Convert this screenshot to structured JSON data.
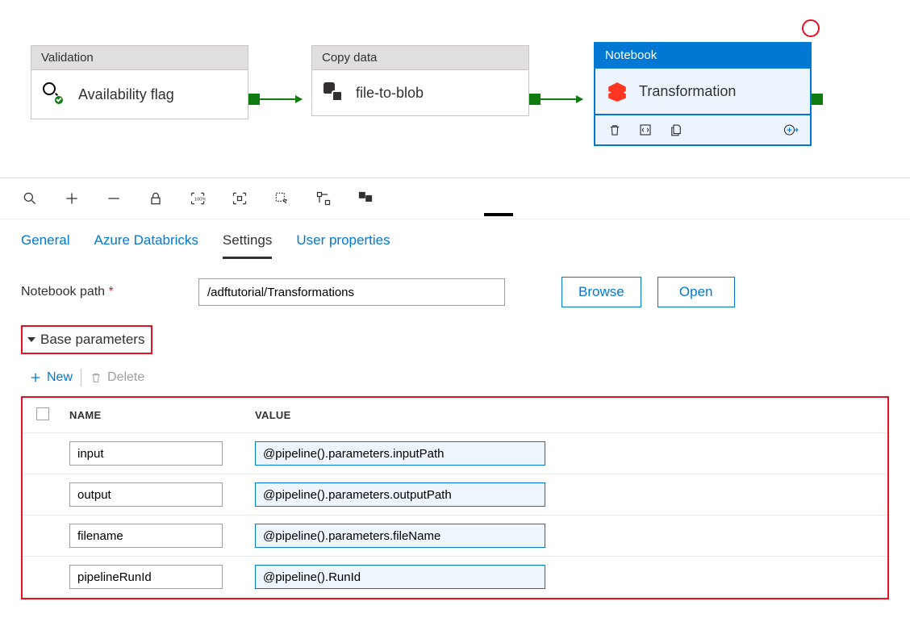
{
  "canvas": {
    "nodes": {
      "validation": {
        "type": "Validation",
        "title": "Availability flag"
      },
      "copydata": {
        "type": "Copy data",
        "title": "file-to-blob"
      },
      "notebook": {
        "type": "Notebook",
        "title": "Transformation"
      }
    }
  },
  "tabs": {
    "general": "General",
    "databricks": "Azure Databricks",
    "settings": "Settings",
    "userprops": "User properties"
  },
  "settings": {
    "notebook_path_label": "Notebook path",
    "notebook_path_value": "/adftutorial/Transformations",
    "browse": "Browse",
    "open": "Open",
    "base_params_label": "Base parameters",
    "new": "New",
    "delete": "Delete",
    "col_name": "NAME",
    "col_value": "VALUE",
    "params": [
      {
        "name": "input",
        "value": "@pipeline().parameters.inputPath"
      },
      {
        "name": "output",
        "value": "@pipeline().parameters.outputPath"
      },
      {
        "name": "filename",
        "value": "@pipeline().parameters.fileName"
      },
      {
        "name": "pipelineRunId",
        "value": "@pipeline().RunId"
      }
    ]
  }
}
